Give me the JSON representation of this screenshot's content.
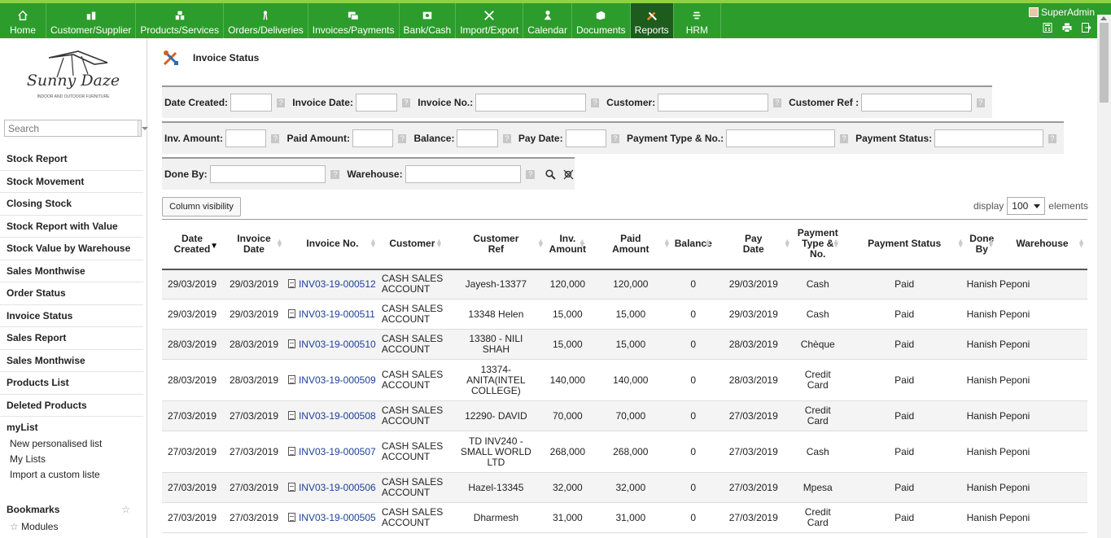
{
  "nav": [
    {
      "label": "Home",
      "icon": "home-icon"
    },
    {
      "label": "Customer/Supplier",
      "icon": "customer-supplier-icon"
    },
    {
      "label": "Products/Services",
      "icon": "products-icon"
    },
    {
      "label": "Orders/Deliveries",
      "icon": "orders-icon"
    },
    {
      "label": "Invoices/Payments",
      "icon": "invoices-icon"
    },
    {
      "label": "Bank/Cash",
      "icon": "bank-icon"
    },
    {
      "label": "Import/Export",
      "icon": "import-export-icon"
    },
    {
      "label": "Calendar",
      "icon": "calendar-icon"
    },
    {
      "label": "Documents",
      "icon": "documents-icon"
    },
    {
      "label": "Reports",
      "icon": "reports-icon"
    },
    {
      "label": "HRM",
      "icon": "hrm-icon"
    }
  ],
  "user": {
    "name": "SuperAdmin"
  },
  "logo": {
    "name": "Sunny Daze",
    "tagline": "INDOOR AND OUTDOOR FURNITURE"
  },
  "search": {
    "placeholder": "Search"
  },
  "sidebar": {
    "items": [
      "Stock Report",
      "Stock Movement",
      "Closing Stock",
      "Stock Report with Value",
      "Stock Value by Warehouse",
      "Sales Monthwise",
      "Order Status",
      "Invoice Status",
      "Sales Report",
      "Sales Monthwise",
      "Products List",
      "Deleted Products"
    ],
    "mylist": {
      "title": "myList",
      "items": [
        "New personalised list",
        "My Lists",
        "Import a custom liste"
      ]
    },
    "bookmarks": {
      "title": "Bookmarks",
      "items": [
        "Modules"
      ]
    }
  },
  "page": {
    "title": "Invoice Status"
  },
  "filters": {
    "date_created": "Date Created:",
    "invoice_date": "Invoice Date:",
    "invoice_no": "Invoice No.:",
    "customer": "Customer:",
    "customer_ref": "Customer Ref :",
    "inv_amount": "Inv. Amount:",
    "paid_amount": "Paid Amount:",
    "balance": "Balance:",
    "pay_date": "Pay Date:",
    "payment_type": "Payment Type & No.:",
    "payment_status": "Payment Status:",
    "done_by": "Done By:",
    "warehouse": "Warehouse:",
    "help": "?"
  },
  "colvis": "Column visibility",
  "display": {
    "before": "display",
    "value": "100",
    "after": "elements"
  },
  "table": {
    "headers": [
      [
        "Date",
        "Created"
      ],
      [
        "Invoice",
        "Date"
      ],
      [
        "Invoice No."
      ],
      [
        "Customer"
      ],
      [
        "Customer",
        "Ref"
      ],
      [
        "Inv.",
        "Amount"
      ],
      [
        "Paid",
        "Amount"
      ],
      [
        "Balance"
      ],
      [
        "Pay",
        "Date"
      ],
      [
        "Payment",
        "Type &",
        "No."
      ],
      [
        "Payment Status"
      ],
      [
        "Done",
        "By"
      ],
      [
        "Warehouse"
      ]
    ],
    "rows": [
      {
        "date_created": "29/03/2019",
        "invoice_date": "29/03/2019",
        "invoice_no": "INV03-19-000512",
        "customer": [
          "CASH SALES",
          "ACCOUNT"
        ],
        "customer_ref": [
          "Jayesh-13377"
        ],
        "inv_amount": "120,000",
        "paid_amount": "120,000",
        "balance": "0",
        "pay_date": "29/03/2019",
        "payment_type": "Cash",
        "payment_status": "Paid",
        "done_by": "Hanish",
        "warehouse": "Peponi"
      },
      {
        "date_created": "29/03/2019",
        "invoice_date": "29/03/2019",
        "invoice_no": "INV03-19-000511",
        "customer": [
          "CASH SALES",
          "ACCOUNT"
        ],
        "customer_ref": [
          "13348 Helen"
        ],
        "inv_amount": "15,000",
        "paid_amount": "15,000",
        "balance": "0",
        "pay_date": "29/03/2019",
        "payment_type": "Cash",
        "payment_status": "Paid",
        "done_by": "Hanish",
        "warehouse": "Peponi"
      },
      {
        "date_created": "28/03/2019",
        "invoice_date": "28/03/2019",
        "invoice_no": "INV03-19-000510",
        "customer": [
          "CASH SALES",
          "ACCOUNT"
        ],
        "customer_ref": [
          "13380 - NILI",
          "SHAH"
        ],
        "inv_amount": "15,000",
        "paid_amount": "15,000",
        "balance": "0",
        "pay_date": "28/03/2019",
        "payment_type": "Chèque",
        "payment_status": "Paid",
        "done_by": "Hanish",
        "warehouse": "Peponi"
      },
      {
        "date_created": "28/03/2019",
        "invoice_date": "28/03/2019",
        "invoice_no": "INV03-19-000509",
        "customer": [
          "CASH SALES",
          "ACCOUNT"
        ],
        "customer_ref": [
          "13374-",
          "ANITA(INTEL",
          "COLLEGE)"
        ],
        "inv_amount": "140,000",
        "paid_amount": "140,000",
        "balance": "0",
        "pay_date": "28/03/2019",
        "payment_type": "Credit Card",
        "payment_status": "Paid",
        "done_by": "Hanish",
        "warehouse": "Peponi"
      },
      {
        "date_created": "27/03/2019",
        "invoice_date": "27/03/2019",
        "invoice_no": "INV03-19-000508",
        "customer": [
          "CASH SALES",
          "ACCOUNT"
        ],
        "customer_ref": [
          "12290- DAVID"
        ],
        "inv_amount": "70,000",
        "paid_amount": "70,000",
        "balance": "0",
        "pay_date": "27/03/2019",
        "payment_type": "Credit Card",
        "payment_status": "Paid",
        "done_by": "Hanish",
        "warehouse": "Peponi"
      },
      {
        "date_created": "27/03/2019",
        "invoice_date": "27/03/2019",
        "invoice_no": "INV03-19-000507",
        "customer": [
          "CASH SALES",
          "ACCOUNT"
        ],
        "customer_ref": [
          "TD INV240 -",
          "SMALL WORLD",
          "LTD"
        ],
        "inv_amount": "268,000",
        "paid_amount": "268,000",
        "balance": "0",
        "pay_date": "27/03/2019",
        "payment_type": "Cash",
        "payment_status": "Paid",
        "done_by": "Hanish",
        "warehouse": "Peponi"
      },
      {
        "date_created": "27/03/2019",
        "invoice_date": "27/03/2019",
        "invoice_no": "INV03-19-000506",
        "customer": [
          "CASH SALES",
          "ACCOUNT"
        ],
        "customer_ref": [
          "Hazel-13345"
        ],
        "inv_amount": "32,000",
        "paid_amount": "32,000",
        "balance": "0",
        "pay_date": "27/03/2019",
        "payment_type": "Mpesa",
        "payment_status": "Paid",
        "done_by": "Hanish",
        "warehouse": "Peponi"
      },
      {
        "date_created": "27/03/2019",
        "invoice_date": "27/03/2019",
        "invoice_no": "INV03-19-000505",
        "customer": [
          "CASH SALES",
          "ACCOUNT"
        ],
        "customer_ref": [
          "Dharmesh"
        ],
        "inv_amount": "31,000",
        "paid_amount": "31,000",
        "balance": "0",
        "pay_date": "27/03/2019",
        "payment_type": "Credit Card",
        "payment_status": "Paid",
        "done_by": "Hanish",
        "warehouse": "Peponi"
      }
    ]
  },
  "colors": {
    "topbar": "#2c9c2c",
    "topbar_accent": "#8fd13f",
    "active_tab": "#1d5c1d",
    "link": "#1e3f9a"
  }
}
